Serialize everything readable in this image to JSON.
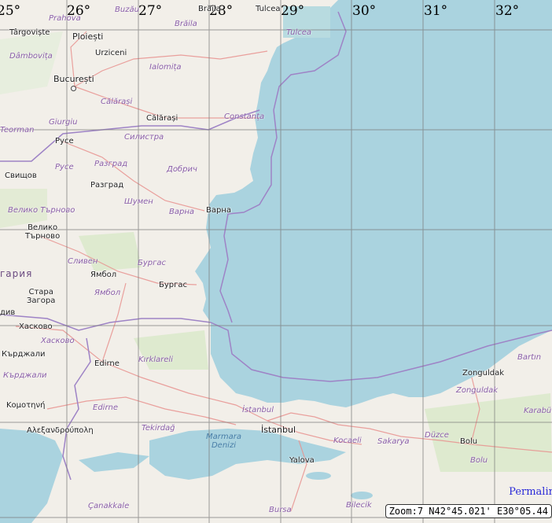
{
  "map": {
    "longitude_labels": [
      "25°",
      "26°",
      "27°",
      "28°",
      "29°",
      "30°",
      "31°",
      "32°"
    ],
    "cities": {
      "targoviste": "Târgoviște",
      "ploiesti": "Ploiești",
      "urziceni": "Urziceni",
      "bucuresti": "București",
      "calarasi": "Călărași",
      "ruse": "Русе",
      "svishtov": "Свищов",
      "razgrad": "Разград",
      "varna": "Варна",
      "veliko_tarnovo": "Велико\nТърново",
      "yambol": "Ямбол",
      "burgas": "Бургас",
      "stara_zagora": "Стара\nЗагора",
      "haskovo": "Хасково",
      "kardzhali": "Кърджали",
      "edirne": "Edirne",
      "komotini": "Κομοτηνή",
      "alexandroupoli": "Αλεξανδρούπολη",
      "istanbul": "İstanbul",
      "yalova": "Yalova",
      "zonguldak": "Zonguldak",
      "bolu": "Bolu",
      "buzau": "Buzău",
      "braila": "Brăila",
      "tulcea": "Tulcea",
      "dobrich": "Добрич"
    },
    "regions": {
      "prahova": "Prahova",
      "buzau_r": "Buzău",
      "braila_r": "Brăila",
      "tulcea_r": "Tulcea",
      "dambovita": "Dâmbovița",
      "ialomita": "Ialomița",
      "calarasi_r": "Călărași",
      "constanta": "Constanța",
      "giurgiu": "Giurgiu",
      "teorman": "Teorman",
      "silistra": "Силистра",
      "ruse_r": "Русе",
      "razgrad_r": "Разград",
      "dobrich_r": "Добрич",
      "shumen": "Шумен",
      "varna_r": "Варна",
      "veliko_r": "Велико Търново",
      "sliven": "Сливен",
      "burgas_r": "Бургас",
      "yambol_r": "Ямбол",
      "haskovo_r": "Хасково",
      "kardzhali_r": "Кърджали",
      "kirklareli": "Kırklareli",
      "edirne_r": "Edirne",
      "tekirdag": "Tekirdağ",
      "istanbul_r": "İstanbul",
      "kocaeli": "Kocaeli",
      "sakarya": "Sakarya",
      "duzce": "Düzce",
      "bolu_r": "Bolu",
      "zonguldak_r": "Zonguldak",
      "bartin": "Bartın",
      "karabuk": "Karabü",
      "canakkale": "Çanakkale",
      "bilecik": "Bilecik",
      "bursa": "Bursa"
    },
    "countries": {
      "bulgaria_partial": "гария",
      "plovdiv_partial": "див"
    },
    "water": {
      "marmara": "Marmara\nDenizi"
    }
  },
  "ui": {
    "permalink_label": "Permalin",
    "coords_readout": "Zoom:7 N42°45.021' E30°05.44"
  },
  "colors": {
    "sea": "#aad3df",
    "land": "#f2efe9",
    "grid": "#888888",
    "border": "#9e83c6",
    "road": "#e8928f",
    "forest": "#cde4c0"
  }
}
